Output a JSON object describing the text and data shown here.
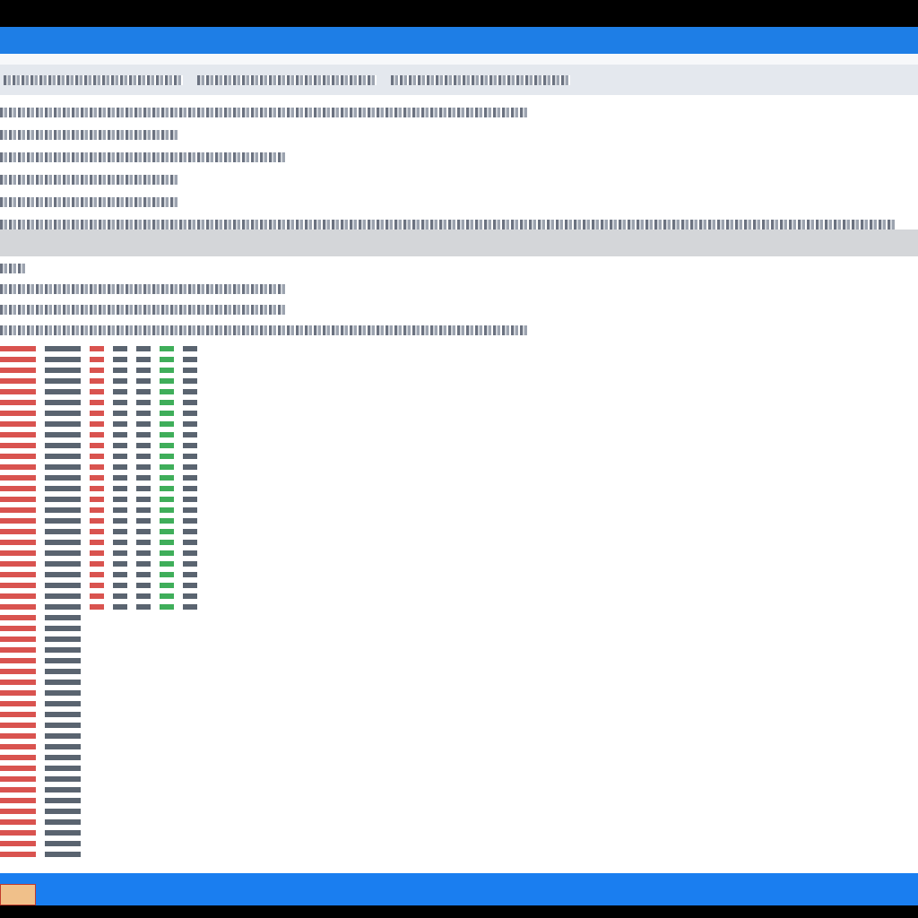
{
  "toolbar": {
    "items": [
      {
        "kind": "long"
      },
      {
        "kind": "long"
      },
      {
        "kind": "long"
      }
    ]
  },
  "upper_pane": {
    "lines": [
      {
        "kind": "long"
      },
      {
        "kind": "short"
      },
      {
        "kind": "medium"
      },
      {
        "kind": "short"
      },
      {
        "kind": "short"
      },
      {
        "kind": "full"
      }
    ]
  },
  "lower_pane": {
    "lines": [
      {
        "kind": "tiny"
      },
      {
        "kind": "medium"
      },
      {
        "kind": "medium"
      },
      {
        "kind": "long"
      }
    ],
    "columns": [
      {
        "kind": "wide",
        "color": "#d9534f"
      },
      {
        "kind": "wide",
        "color": "#5a6470"
      },
      {
        "kind": "narrow",
        "color": "#d9534f"
      },
      {
        "kind": "narrow",
        "color": "#5a6470"
      },
      {
        "kind": "narrow",
        "color": "#5a6470"
      },
      {
        "kind": "narrow",
        "color": "#3fae5a"
      },
      {
        "kind": "narrow",
        "color": "#5a6470"
      }
    ]
  },
  "taskbar": {
    "start": true
  }
}
